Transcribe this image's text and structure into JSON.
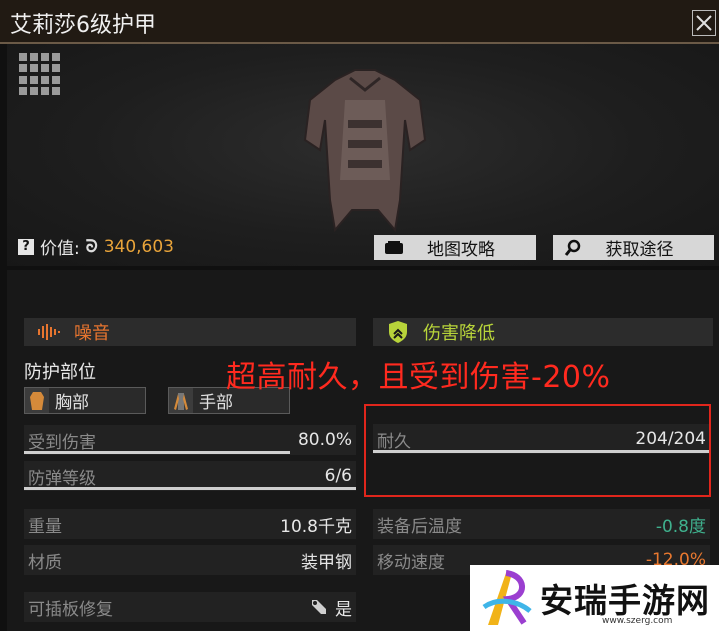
{
  "window": {
    "title": "艾莉莎6级护甲"
  },
  "item": {
    "value_label": "价值:",
    "value_amount": "340,603",
    "buttons": {
      "map_guide": "地图攻略",
      "obtain_route": "获取途径"
    }
  },
  "tags": {
    "noise": "噪音",
    "damage_reduction": "伤害降低"
  },
  "protection": {
    "label": "防护部位",
    "parts": [
      "胸部",
      "手部"
    ]
  },
  "annotation": "超高耐久，且受到伤害-20%",
  "stats": {
    "damage_taken": {
      "label": "受到伤害",
      "value": "80.0%",
      "fill": 0.8
    },
    "bulletproof_level": {
      "label": "防弹等级",
      "value": "6/6",
      "fill": 1.0
    },
    "durability": {
      "label": "耐久",
      "value": "204/204",
      "fill": 1.0
    },
    "weight": {
      "label": "重量",
      "value": "10.8千克"
    },
    "material": {
      "label": "材质",
      "value": "装甲钢"
    },
    "temperature": {
      "label": "装备后温度",
      "value": "-0.8度"
    },
    "move_speed": {
      "label": "移动速度",
      "value": "-12.0%"
    },
    "plate_repair": {
      "label": "可插板修复",
      "value": "是"
    }
  },
  "colors": {
    "value": "#e9a43a",
    "noise": "#e7752f",
    "dmg_reduction": "#b8d43a",
    "positive": "#3fb08d",
    "negative": "#e8782f",
    "annotation": "#ff2a1f"
  },
  "watermark": {
    "name": "安瑞手游网",
    "url": "www.szerg.com"
  }
}
